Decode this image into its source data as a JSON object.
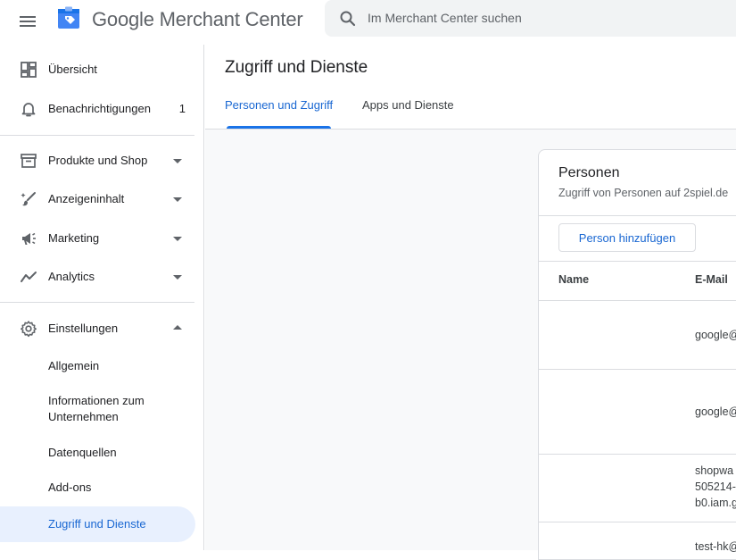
{
  "header": {
    "brand": "Google Merchant Center",
    "search_placeholder": "Im Merchant Center suchen"
  },
  "sidebar": {
    "items": [
      {
        "label": "Übersicht",
        "icon": "dashboard-icon"
      },
      {
        "label": "Benachrichtigungen",
        "icon": "bell-icon",
        "badge": "1"
      },
      {
        "label": "Produkte und Shop",
        "icon": "store-icon"
      },
      {
        "label": "Anzeigeninhalt",
        "icon": "brush-icon"
      },
      {
        "label": "Marketing",
        "icon": "megaphone-icon"
      },
      {
        "label": "Analytics",
        "icon": "trend-icon"
      },
      {
        "label": "Einstellungen",
        "icon": "gear-icon"
      }
    ],
    "sub_items": [
      {
        "label": "Allgemein"
      },
      {
        "label": "Informationen zum Unternehmen"
      },
      {
        "label": "Datenquellen"
      },
      {
        "label": "Add-ons"
      },
      {
        "label": "Zugriff und Dienste",
        "active": true
      }
    ]
  },
  "main": {
    "title": "Zugriff und Dienste",
    "tabs": [
      {
        "label": "Personen und Zugriff",
        "active": true
      },
      {
        "label": "Apps und Dienste",
        "active": false
      }
    ],
    "card": {
      "title": "Personen",
      "subtitle": "Zugriff von Personen auf 2spiel.de",
      "add_button": "Person hinzufügen",
      "columns": [
        "Name",
        "E-Mail"
      ],
      "rows": [
        {
          "name": "",
          "email_lines": [
            "google@"
          ]
        },
        {
          "name": "",
          "email_lines": [
            "google@"
          ]
        },
        {
          "name": "",
          "email_lines": [
            "shopwa",
            "505214-",
            "b0.iam.g"
          ]
        },
        {
          "name": "",
          "email_lines": [
            "test-hk@"
          ]
        }
      ]
    }
  },
  "colors": {
    "accent": "#1a73e8",
    "active_text": "#1967d2",
    "active_bg": "#e8f0fe",
    "divider": "#dadce0"
  }
}
